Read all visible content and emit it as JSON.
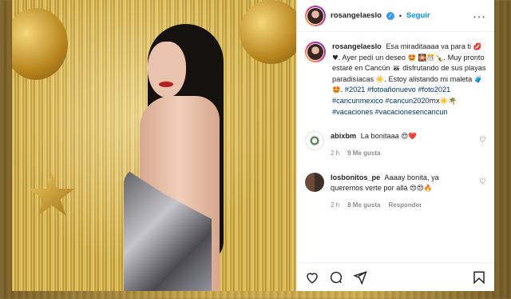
{
  "post": {
    "username": "rosangelaeslo",
    "follow_label": "Seguir",
    "separator": "•",
    "more_label": "···",
    "caption": {
      "username": "rosangelaeslo",
      "part1": "Esa miraditaaaa va para ti",
      "part1_emoji": "💋♥.",
      "part2": "Ayer pedí un deseo",
      "part2_emoji": "🤩",
      "part3_emoji": "🎇🎊🍾.",
      "part4": "Muy pronto estaré en Cancún",
      "part4_emoji": "🦝",
      "part5": "disfrutando de sus playas paradisíacas",
      "part5_emoji": "☀️.",
      "part6": "Estoy alistando mi maleta",
      "part6_emoji": "🧳🤩.",
      "tags": [
        "#2021",
        "#fotoañonuevo",
        "#foto2021",
        "#cancunmexico",
        "#cancun2020",
        "#vacaciones",
        "#vacacionesencancun"
      ],
      "tag5_suffix": "mx☀️🌴"
    }
  },
  "comments": [
    {
      "username": "abixbm",
      "text": "La bonitaaa",
      "emoji": "😍❤️",
      "time": "2 h",
      "likes": "9 Me gusta",
      "reply": ""
    },
    {
      "username": "losbonitos_pe",
      "text": "Aaaay bonita, ya queremos verte por allá",
      "emoji": "😍😍🔥",
      "time": "2 h",
      "likes": "8 Me gusta",
      "reply": "Responder"
    }
  ],
  "icons": [
    "heart-icon",
    "comment-icon",
    "share-icon",
    "bookmark-icon",
    "verified-icon",
    "more-icon"
  ],
  "colors": {
    "link": "#0095f6",
    "hashtag": "#00376b",
    "verified": "#3897f0",
    "text": "#262626",
    "muted": "#8e8e8e"
  }
}
